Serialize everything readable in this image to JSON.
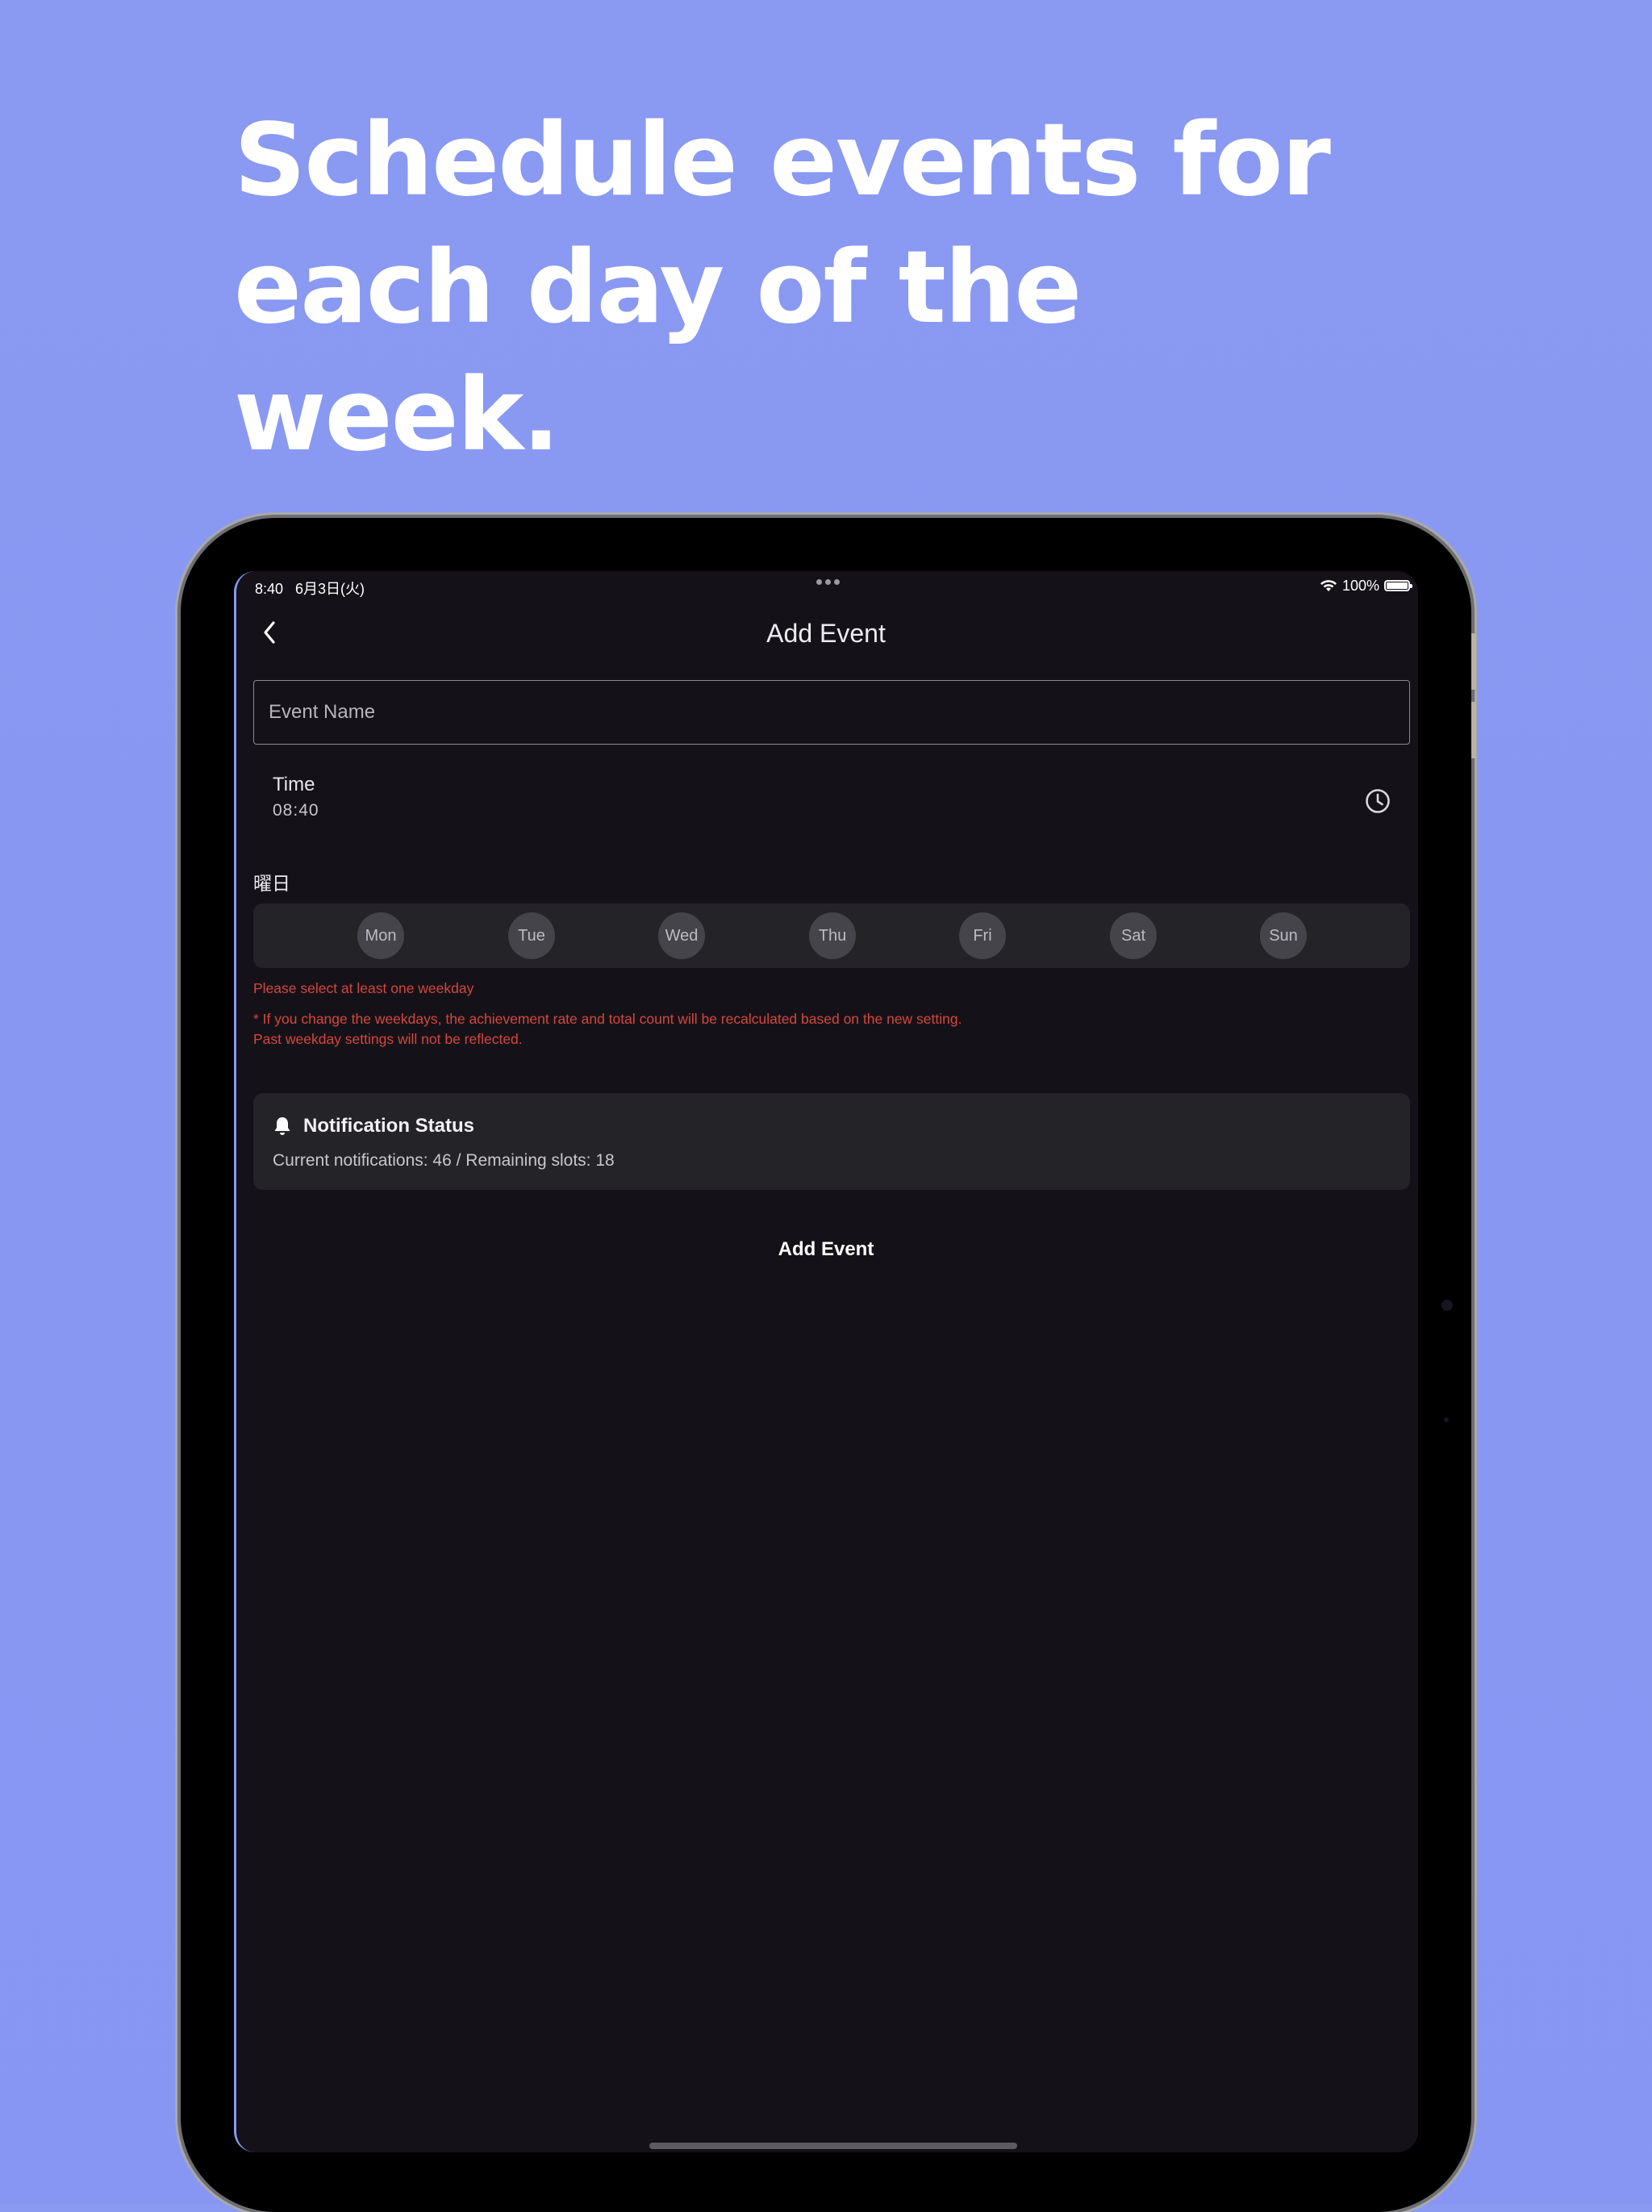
{
  "promo": {
    "headline_lines": [
      "Schedule events for",
      "each day of the",
      "week."
    ]
  },
  "status_bar": {
    "time_date": "8:40   6月3日(火)",
    "battery": "100%",
    "battery_level": 1.0
  },
  "nav": {
    "title": "Add Event",
    "back_icon": "chevron-left-icon"
  },
  "form": {
    "event_name_placeholder": "Event Name",
    "event_name_value": "",
    "time_label": "Time",
    "time_value": "08:40",
    "time_icon": "clock-icon",
    "weekday_title": "曜日",
    "weekdays": [
      "Mon",
      "Tue",
      "Wed",
      "Thu",
      "Fri",
      "Sat",
      "Sun"
    ],
    "weekday_error": "Please select at least one weekday",
    "weekday_note_lines": [
      "* If you change the weekdays, the achievement rate and total count will be recalculated based on the new setting.",
      "Past weekday settings will not be reflected."
    ]
  },
  "notification": {
    "icon": "bell-icon",
    "title": "Notification Status",
    "text": "Current notifications: 46 / Remaining slots: 18"
  },
  "actions": {
    "add_event_label": "Add Event"
  },
  "colors": {
    "background": "#8898f2",
    "screen": "#141218",
    "card": "#242327",
    "error": "#d5463c"
  }
}
